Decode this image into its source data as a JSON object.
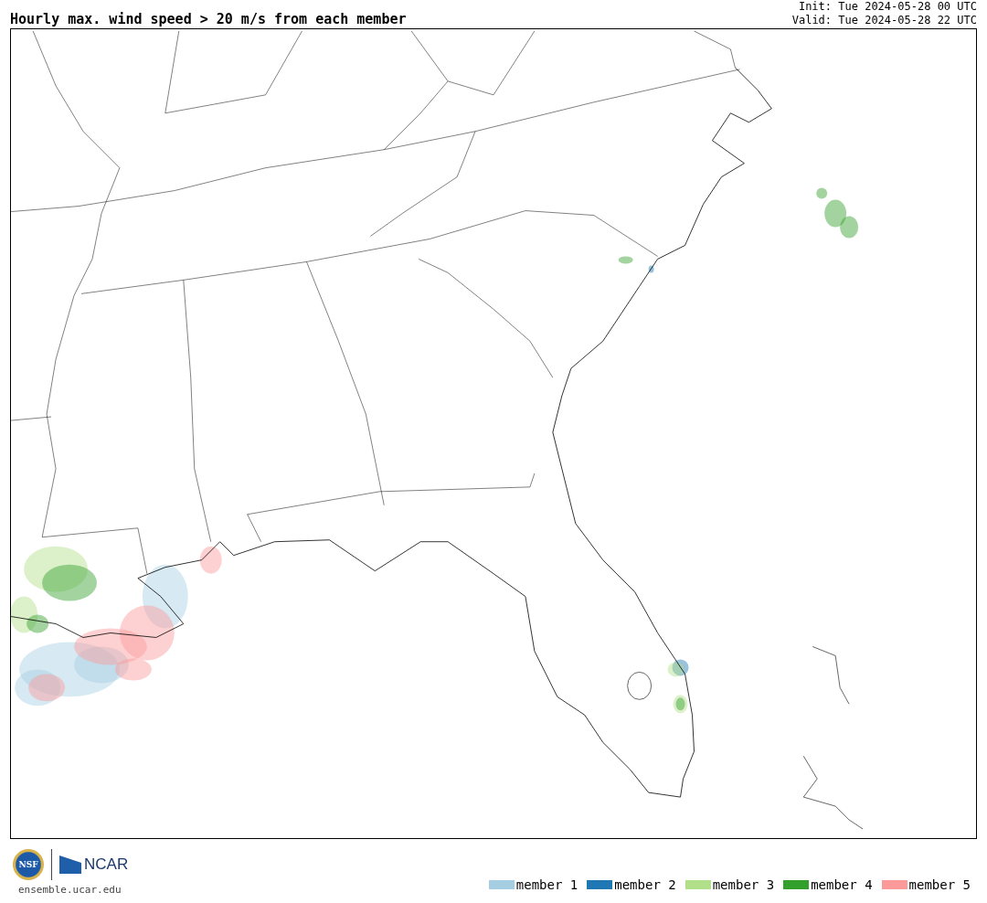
{
  "header": {
    "title": "Hourly max. wind speed > 20 m/s from each member",
    "init": "Init: Tue 2024-05-28 00 UTC",
    "valid": "Valid: Tue 2024-05-28 22 UTC"
  },
  "footer": {
    "nsf_logo": "NSF",
    "ncar_logo": "NCAR",
    "url": "ensemble.ucar.edu"
  },
  "legend": [
    {
      "label": "member 1",
      "color": "#a6cee3"
    },
    {
      "label": "member 2",
      "color": "#1f78b4"
    },
    {
      "label": "member 3",
      "color": "#b2df8a"
    },
    {
      "label": "member 4",
      "color": "#33a02c"
    },
    {
      "label": "member 5",
      "color": "#fb9a99"
    }
  ]
}
